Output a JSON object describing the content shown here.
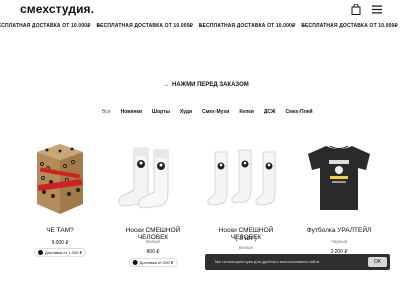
{
  "header": {
    "logo": "смехстудия.",
    "cart_icon": "shopping-bag-icon",
    "menu_icon": "hamburger-menu-icon"
  },
  "ticker": {
    "text": "БЕСПЛАТНАЯ ДОСТАВКА ОТ 10.000₽",
    "separator": "•"
  },
  "notice": {
    "arrow": "→",
    "text": "НАЖМИ ПЕРЕД ЗАКАЗОМ"
  },
  "categories": [
    "Все",
    "Новинки",
    "Шорты",
    "Худи",
    "Смех-Мухи",
    "Кепки",
    "ДСЖ",
    "Смех-Плей"
  ],
  "products": [
    {
      "title": "ЧЕ ТАМ?",
      "title2": "",
      "color": "",
      "price": "9.000 ₽",
      "shipping": "Доставка от 1.200 ₽"
    },
    {
      "title": "Носки СМЕШНОЙ ЧЕЛОВЕК",
      "title2": "",
      "color": "Белый",
      "price": "800 ₽",
      "shipping": "Доставка от 200 ₽"
    },
    {
      "title": "Носки СМЕШНОЙ ЧЕЛОВЕК",
      "title2": "( 3 шт )",
      "color": "Белый",
      "price": "",
      "shipping": ""
    },
    {
      "title": "Футболка УРАЛТЕЙЛ",
      "title2": "",
      "color": "Черный",
      "price": "2.200 ₽",
      "shipping": ""
    }
  ],
  "cookie": {
    "text": "Мы используем куки для удобного использования сайта",
    "ok_label": "OK"
  }
}
